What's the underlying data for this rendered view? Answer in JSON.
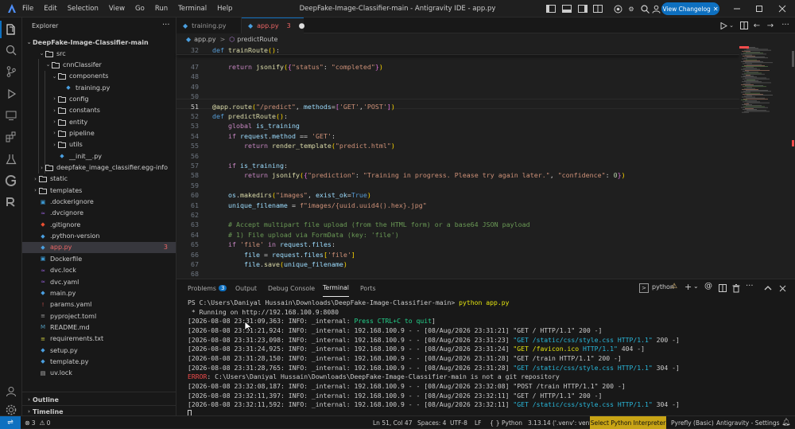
{
  "titlebar": {
    "menus": [
      "File",
      "Edit",
      "Selection",
      "View",
      "Go",
      "Run",
      "Terminal",
      "Help"
    ],
    "title": "DeepFake-Image-Classifier-main - Antigravity IDE - app.py",
    "changelog": "View Changelog"
  },
  "explorer": {
    "header": "Explorer",
    "root": "DeepFake-Image-Classifier-main",
    "items": [
      {
        "label": "src",
        "type": "folder-open"
      },
      {
        "label": "cnnClassifer",
        "type": "folder-open"
      },
      {
        "label": "components",
        "type": "folder-open"
      },
      {
        "label": "training.py",
        "type": "py"
      },
      {
        "label": "config",
        "type": "folder"
      },
      {
        "label": "constants",
        "type": "folder"
      },
      {
        "label": "entity",
        "type": "folder"
      },
      {
        "label": "pipeline",
        "type": "folder"
      },
      {
        "label": "utils",
        "type": "folder"
      },
      {
        "label": "__init__.py",
        "type": "py"
      },
      {
        "label": "deepfake_image_classifier.egg-info",
        "type": "folder"
      },
      {
        "label": "static",
        "type": "folder"
      },
      {
        "label": "templates",
        "type": "folder"
      },
      {
        "label": ".dockerignore",
        "type": "docker"
      },
      {
        "label": ".dvcignore",
        "type": "dvc"
      },
      {
        "label": ".gitignore",
        "type": "git"
      },
      {
        "label": ".python-version",
        "type": "pyver"
      },
      {
        "label": "app.py",
        "type": "py",
        "badge": "3"
      },
      {
        "label": "Dockerfile",
        "type": "docker"
      },
      {
        "label": "dvc.lock",
        "type": "dvc"
      },
      {
        "label": "dvc.yaml",
        "type": "dvc"
      },
      {
        "label": "main.py",
        "type": "py"
      },
      {
        "label": "params.yaml",
        "type": "yaml"
      },
      {
        "label": "pyproject.toml",
        "type": "toml"
      },
      {
        "label": "README.md",
        "type": "md"
      },
      {
        "label": "requirements.txt",
        "type": "txt"
      },
      {
        "label": "setup.py",
        "type": "py"
      },
      {
        "label": "template.py",
        "type": "py"
      },
      {
        "label": "uv.lock",
        "type": "lock"
      }
    ],
    "outline": "Outline",
    "timeline": "Timeline"
  },
  "tabs": [
    {
      "label": "training.py"
    },
    {
      "label": "app.py",
      "badge": "3"
    }
  ],
  "breadcrumb": {
    "file": "app.py",
    "sep": ">",
    "symbol": "predictRoute"
  },
  "code": {
    "lines": [
      {
        "n": "32",
        "src": "def trainRoute():"
      },
      {
        "n": "47",
        "src": "    return jsonify({\"status\": \"completed\"})"
      },
      {
        "n": "48",
        "src": ""
      },
      {
        "n": "49",
        "src": ""
      },
      {
        "n": "50",
        "src": ""
      },
      {
        "n": "51",
        "src": "@app.route(\"/predict\", methods=['GET','POST'])"
      },
      {
        "n": "52",
        "src": "def predictRoute():"
      },
      {
        "n": "53",
        "src": "    global is_training"
      },
      {
        "n": "54",
        "src": "    if request.method == 'GET':"
      },
      {
        "n": "55",
        "src": "        return render_template(\"predict.html\")"
      },
      {
        "n": "56",
        "src": ""
      },
      {
        "n": "57",
        "src": "    if is_training:"
      },
      {
        "n": "58",
        "src": "        return jsonify({\"prediction\": \"Training in progress. Please try again later.\", \"confidence\": 0})"
      },
      {
        "n": "59",
        "src": ""
      },
      {
        "n": "60",
        "src": "    os.makedirs(\"images\", exist_ok=True)"
      },
      {
        "n": "61",
        "src": "    unique_filename = f\"images/{uuid.uuid4().hex}.jpg\""
      },
      {
        "n": "62",
        "src": ""
      },
      {
        "n": "63",
        "src": "    # Accept multipart file upload (from the HTML form) or a base64 JSON payload"
      },
      {
        "n": "64",
        "src": "    # 1) File upload via FormData (key: 'file')"
      },
      {
        "n": "65",
        "src": "    if 'file' in request.files:"
      },
      {
        "n": "66",
        "src": "        file = request.files['file']"
      },
      {
        "n": "67",
        "src": "        file.save(unique_filename)"
      },
      {
        "n": "68",
        "src": ""
      }
    ]
  },
  "panel": {
    "tabs": [
      "Problems",
      "Output",
      "Debug Console",
      "Terminal",
      "Ports"
    ],
    "problems_badge": "3",
    "terminal_name": "python",
    "lines": [
      "PS C:\\Users\\Daniyal Hussain\\Downloads\\DeepFake-Image-Classifier-main> python app.py",
      " * Running on http://192.168.100.9:8080",
      "[2026-08-08 23:31:09,363: INFO: _internal: Press CTRL+C to quit]",
      "[2026-08-08 23:31:21,924: INFO: _internal: 192.168.100.9 - - [08/Aug/2026 23:31:21] \"GET / HTTP/1.1\" 200 -]",
      "[2026-08-08 23:31:23,098: INFO: _internal: 192.168.100.9 - - [08/Aug/2026 23:31:23] \"GET /static/css/style.css HTTP/1.1\" 200 -]",
      "[2026-08-08 23:31:24,925: INFO: _internal: 192.168.100.9 - - [08/Aug/2026 23:31:24] \"GET /favicon.ico HTTP/1.1\" 404 -]",
      "[2026-08-08 23:31:28,150: INFO: _internal: 192.168.100.9 - - [08/Aug/2026 23:31:28] \"GET /train HTTP/1.1\" 200 -]",
      "[2026-08-08 23:31:28,765: INFO: _internal: 192.168.100.9 - - [08/Aug/2026 23:31:28] \"GET /static/css/style.css HTTP/1.1\" 304 -]",
      "ERROR: C:\\Users\\Daniyal Hussain\\Downloads\\DeepFake-Image-Classifier-main is not a git repository",
      "[2026-08-08 23:32:08,187: INFO: _internal: 192.168.100.9 - - [08/Aug/2026 23:32:08] \"POST /train HTTP/1.1\" 200 -]",
      "[2026-08-08 23:32:11,397: INFO: _internal: 192.168.100.9 - - [08/Aug/2026 23:32:11] \"GET / HTTP/1.1\" 200 -]",
      "[2026-08-08 23:32:11,592: INFO: _internal: 192.168.100.9 - - [08/Aug/2026 23:32:11] \"GET /static/css/style.css HTTP/1.1\" 304 -]"
    ]
  },
  "statusbar": {
    "problems": "3",
    "warnings": "0",
    "position": "Ln 51, Col 47",
    "spaces": "Spaces: 4",
    "encoding": "UTF-8",
    "eol": "LF",
    "lang": "Python",
    "interpreter": "3.13.14 ('.venv': venv)",
    "select_interpreter": "Select Python Interpreter",
    "pyrefly": "Pyrefly (Basic)",
    "settings": "Antigravity - Settings"
  },
  "colors": {
    "accent": "#0e70c0",
    "status_select": "#c8a415",
    "error": "#f14c4c"
  }
}
